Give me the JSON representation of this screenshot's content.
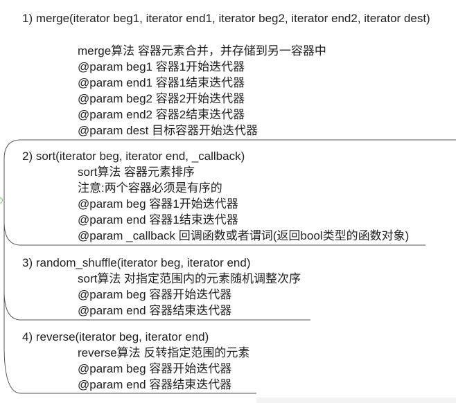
{
  "sections": [
    {
      "heading": "1)  merge(iterator beg1, iterator end1, iterator beg2, iterator end2, iterator dest)",
      "lines": [
        "merge算法 容器元素合并，并存储到另一容器中",
        "@param beg1 容器1开始迭代器",
        "@param end1 容器1结束迭代器",
        "@param beg2 容器2开始迭代器",
        "@param end2 容器2结束迭代器",
        "@param dest  目标容器开始迭代器"
      ]
    },
    {
      "heading": "2)  sort(iterator beg, iterator end, _callback)",
      "lines": [
        "sort算法 容器元素排序",
        "注意:两个容器必须是有序的",
        "@param beg 容器1开始迭代器",
        "@param end 容器1结束迭代器",
        "@param _callback 回调函数或者谓词(返回bool类型的函数对象)"
      ]
    },
    {
      "heading": "3)  random_shuffle(iterator beg, iterator end)",
      "lines": [
        "sort算法 对指定范围内的元素随机调整次序",
        "@param beg 容器开始迭代器",
        "@param end 容器结束迭代器"
      ]
    },
    {
      "heading": "4)  reverse(iterator beg, iterator end)",
      "lines": [
        "reverse算法 反转指定范围的元素",
        "@param beg 容器开始迭代器",
        "@param end 容器结束迭代器"
      ]
    }
  ],
  "colors": {
    "text": "#222222",
    "connector": "#555555",
    "node": "#7cc36b"
  }
}
